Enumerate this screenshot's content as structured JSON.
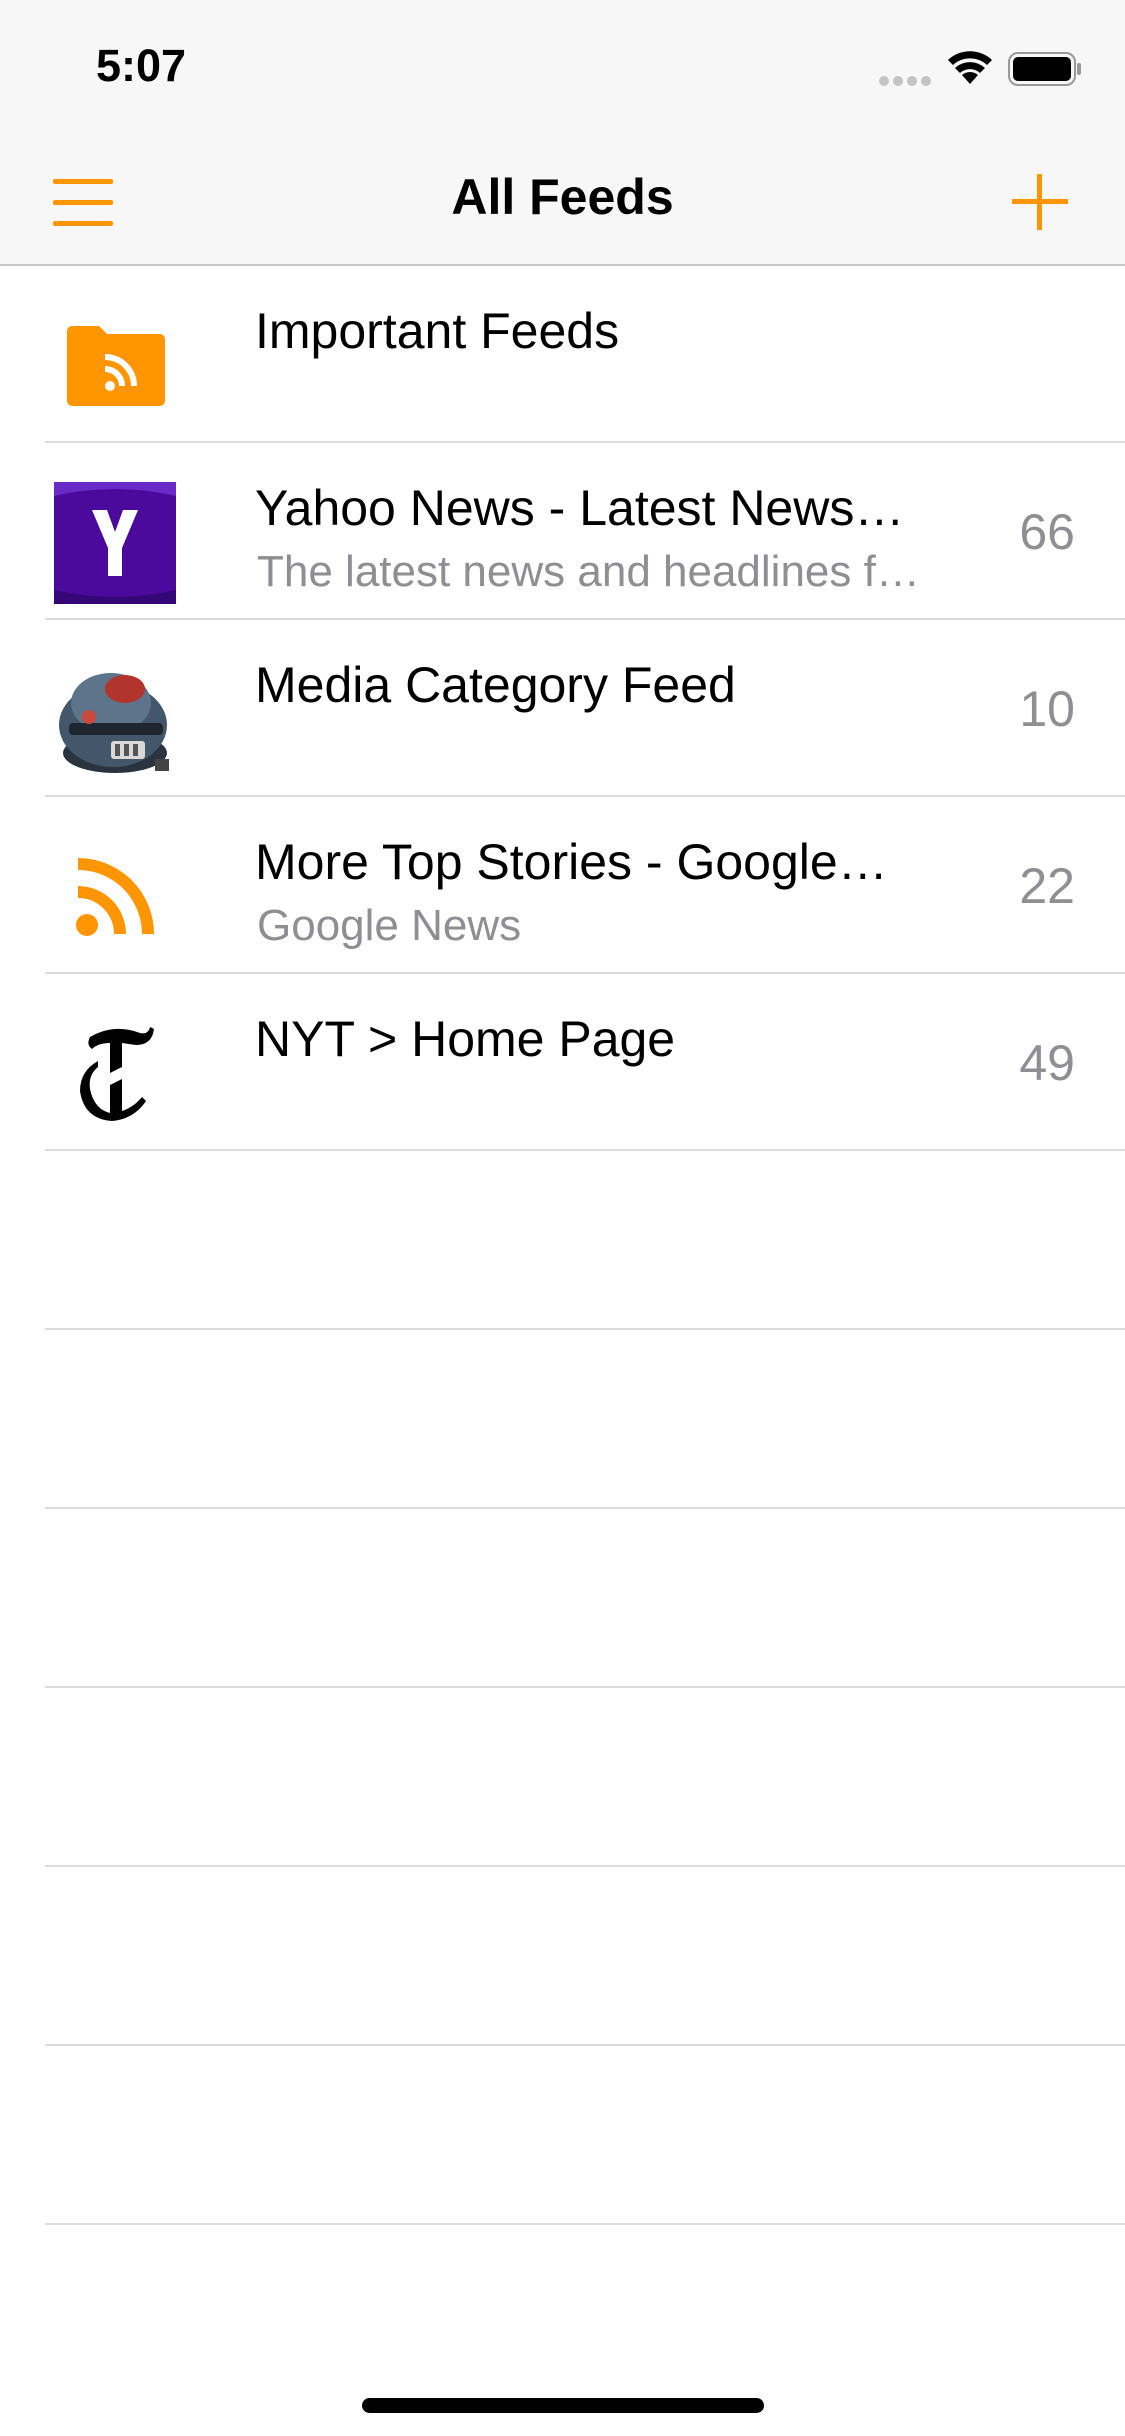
{
  "status_bar": {
    "time": "5:07"
  },
  "nav": {
    "title": "All Feeds",
    "menu_icon": "hamburger-menu-icon",
    "add_icon": "plus-icon",
    "accent_color": "#ff9500"
  },
  "feeds": [
    {
      "title": "Important Feeds",
      "subtitle": "",
      "count": "",
      "icon": "folder-rss-icon"
    },
    {
      "title": "Yahoo News - Latest News…",
      "subtitle": "The latest news and headlines f…",
      "count": "66",
      "icon": "yahoo-logo-icon"
    },
    {
      "title": "Media Category Feed",
      "subtitle": "",
      "count": "10",
      "icon": "robot-helmet-icon"
    },
    {
      "title": "More Top Stories - Google…",
      "subtitle": "Google News",
      "count": "22",
      "icon": "rss-icon"
    },
    {
      "title": "NYT > Home Page",
      "subtitle": "",
      "count": "49",
      "icon": "nyt-logo-icon"
    }
  ]
}
